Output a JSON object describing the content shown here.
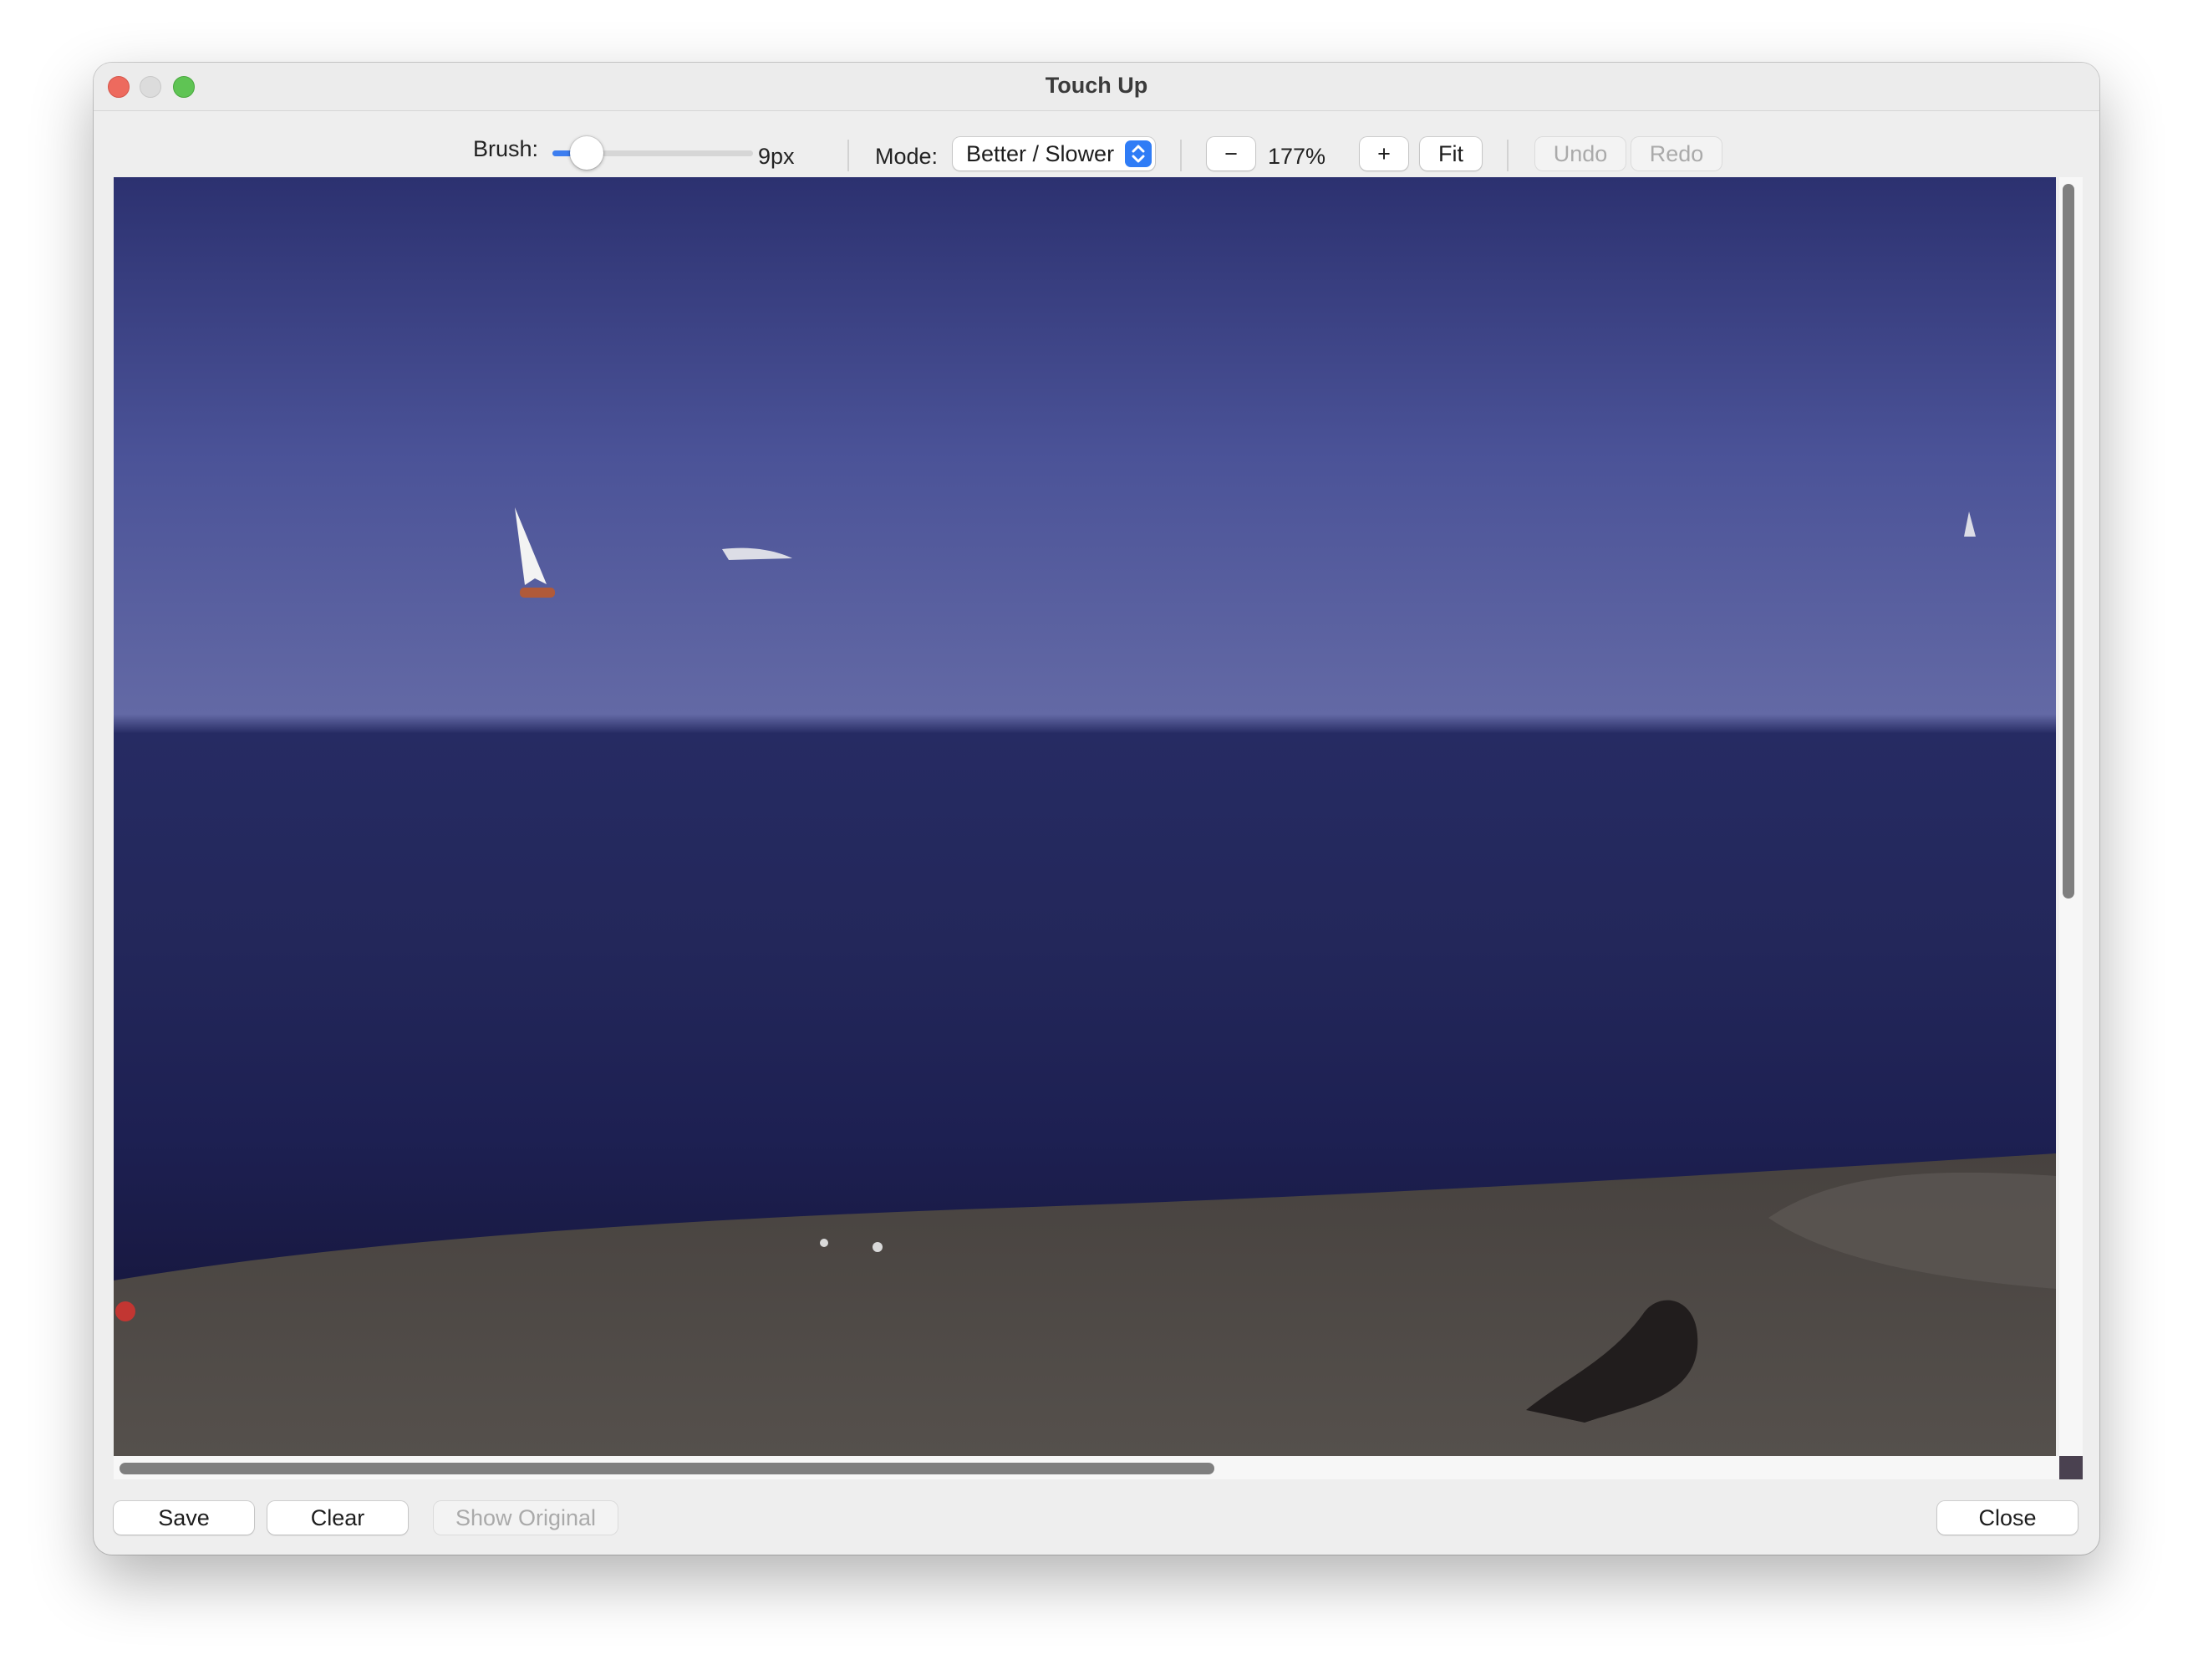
{
  "window": {
    "title": "Touch Up"
  },
  "toolbar": {
    "brush_label": "Brush:",
    "brush_value": 9,
    "brush_value_text": "9px",
    "mode_label": "Mode:",
    "mode_value": "Better / Slower",
    "zoom_out_label": "−",
    "zoom_value": "177%",
    "zoom_in_label": "+",
    "fit_label": "Fit",
    "undo_label": "Undo",
    "redo_label": "Redo"
  },
  "footer": {
    "save_label": "Save",
    "clear_label": "Clear",
    "show_original_label": "Show Original",
    "close_label": "Close"
  },
  "colors": {
    "accent": "#3d7ef0",
    "close_traffic": "#ed6a5e",
    "zoom_traffic": "#5fc454"
  },
  "icons": {
    "close": "close-icon",
    "minimize": "minimize-icon",
    "zoom": "zoom-icon",
    "select_chevron": "chevron-up-down-icon"
  }
}
